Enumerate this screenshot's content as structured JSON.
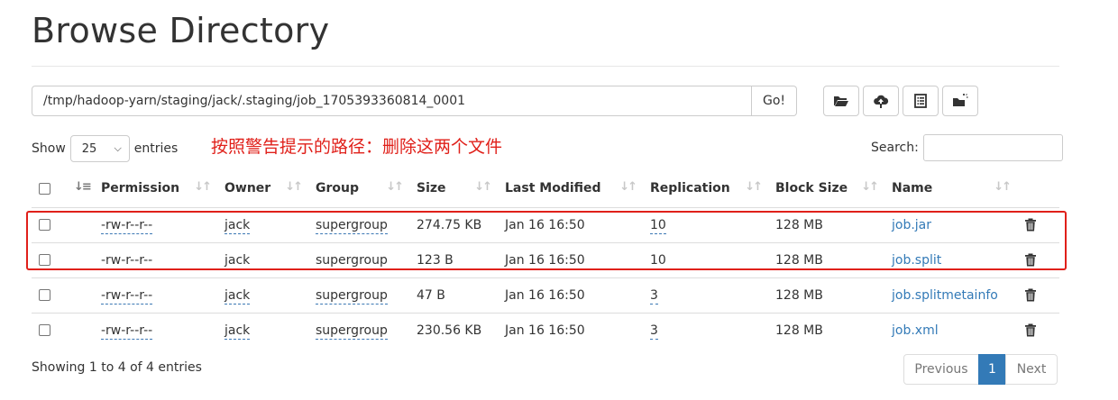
{
  "page": {
    "title": "Browse Directory"
  },
  "path_bar": {
    "value": "/tmp/hadoop-yarn/staging/jack/.staging/job_1705393360814_0001",
    "go_label": "Go!"
  },
  "toolbar": {
    "icons": [
      "folder-open-icon",
      "cloud-upload-icon",
      "list-icon",
      "folder-create-icon"
    ]
  },
  "entries": {
    "show_label": "Show",
    "selected": "25",
    "entries_label": "entries"
  },
  "annotation": {
    "text": "按照警告提示的路径：删除这两个文件",
    "color": "#e0201a"
  },
  "search": {
    "label": "Search:",
    "value": ""
  },
  "table": {
    "headers": [
      "Permission",
      "Owner",
      "Group",
      "Size",
      "Last Modified",
      "Replication",
      "Block Size",
      "Name"
    ],
    "rows": [
      {
        "permission": "-rw-r--r--",
        "owner": "jack",
        "group": "supergroup",
        "size": "274.75 KB",
        "modified": "Jan 16 16:50",
        "replication": "10",
        "block_size": "128 MB",
        "name": "job.jar"
      },
      {
        "permission": "-rw-r--r--",
        "owner": "jack",
        "group": "supergroup",
        "size": "123 B",
        "modified": "Jan 16 16:50",
        "replication": "10",
        "block_size": "128 MB",
        "name": "job.split"
      },
      {
        "permission": "-rw-r--r--",
        "owner": "jack",
        "group": "supergroup",
        "size": "47 B",
        "modified": "Jan 16 16:50",
        "replication": "3",
        "block_size": "128 MB",
        "name": "job.splitmetainfo"
      },
      {
        "permission": "-rw-r--r--",
        "owner": "jack",
        "group": "supergroup",
        "size": "230.56 KB",
        "modified": "Jan 16 16:50",
        "replication": "3",
        "block_size": "128 MB",
        "name": "job.xml"
      }
    ]
  },
  "footer": {
    "info": "Showing 1 to 4 of 4 entries",
    "previous": "Previous",
    "current_page": "1",
    "next": "Next"
  },
  "colors": {
    "link": "#337ab7",
    "active_page": "#337ab7",
    "highlight": "#e0201a"
  }
}
